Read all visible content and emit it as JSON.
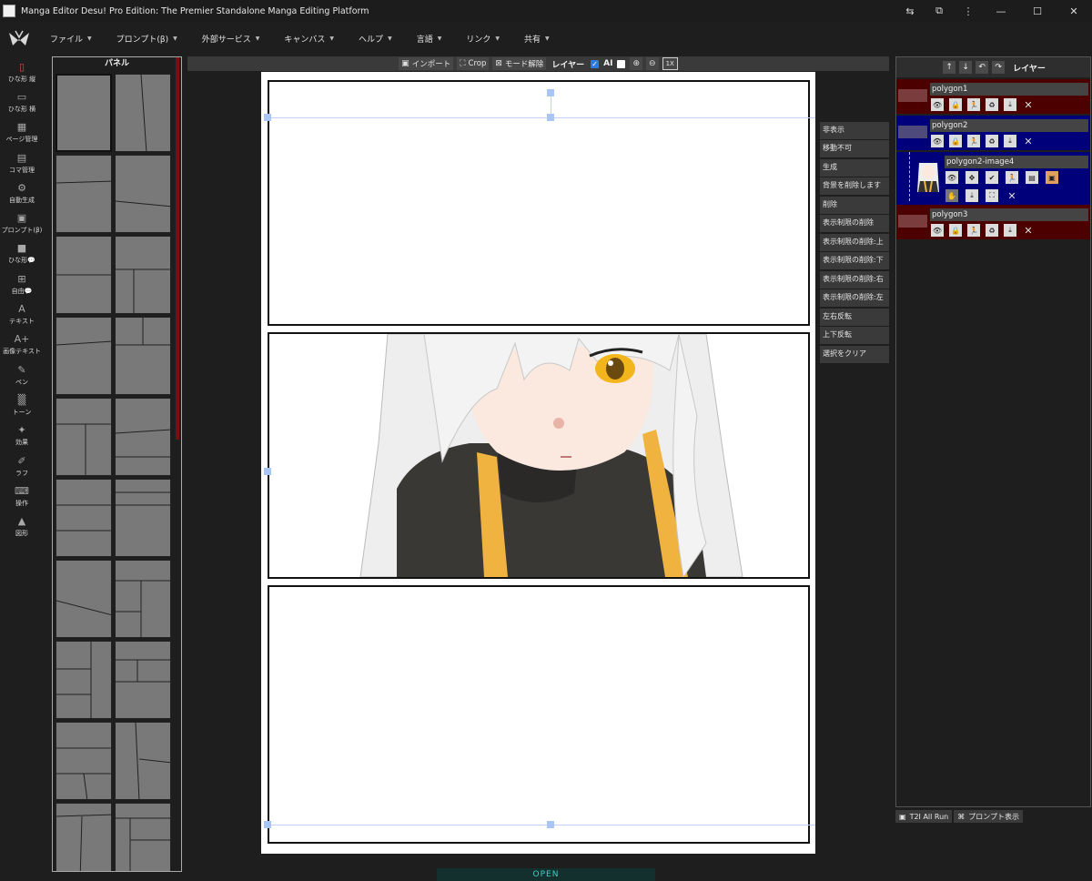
{
  "window": {
    "title": "Manga Editor Desu! Pro Edition: The Premier Standalone Manga Editing Platform"
  },
  "menubar": {
    "items": [
      "ファイル",
      "プロンプト(β)",
      "外部サービス",
      "キャンバス",
      "ヘルプ",
      "言語",
      "リンク",
      "共有"
    ]
  },
  "tools": [
    {
      "label": "ひな形 縦",
      "icon": "portrait-rect-icon"
    },
    {
      "label": "ひな形 横",
      "icon": "landscape-rect-icon"
    },
    {
      "label": "ページ管理",
      "icon": "grid-icon"
    },
    {
      "label": "コマ管理",
      "icon": "panels-icon"
    },
    {
      "label": "自動生成",
      "icon": "robot-icon"
    },
    {
      "label": "プロンプト(β)",
      "icon": "clipboard-icon"
    },
    {
      "label": "ひな形💬",
      "icon": "speech-bubble-icon"
    },
    {
      "label": "自由💬",
      "icon": "bubble-plus-icon"
    },
    {
      "label": "テキスト",
      "icon": "text-icon"
    },
    {
      "label": "画像テキスト",
      "icon": "image-text-icon"
    },
    {
      "label": "ペン",
      "icon": "pen-icon"
    },
    {
      "label": "トーン",
      "icon": "tone-icon"
    },
    {
      "label": "効果",
      "icon": "effect-icon"
    },
    {
      "label": "ラフ",
      "icon": "rough-icon"
    },
    {
      "label": "操作",
      "icon": "gamepad-icon"
    },
    {
      "label": "図形",
      "icon": "shapes-icon"
    }
  ],
  "panel_list": {
    "title": "パネル"
  },
  "canvas_toolbar": {
    "import_label": "インポート",
    "crop_label": "Crop",
    "mode_release_label": "モード解除",
    "layer_label": "レイヤー",
    "ai_label": "AI",
    "ai_checked": true,
    "second_checked": false,
    "zoom_in_icon": "zoom-in-icon",
    "zoom_out_icon": "zoom-out-icon",
    "reset_label": "1X"
  },
  "context_menu": {
    "items": [
      "非表示",
      "移動不可",
      "生成",
      "背景を削除します",
      "削除",
      "表示制限の削除",
      "表示制限の削除:上",
      "表示制限の削除:下",
      "表示制限の削除:右",
      "表示制限の削除:左",
      "左右反転",
      "上下反転",
      "選択をクリア"
    ]
  },
  "layers": {
    "title": "レイヤー",
    "items": [
      {
        "name": "polygon1",
        "swatch": "#7a3c3c",
        "bg": "#4d0000"
      },
      {
        "name": "polygon2",
        "swatch": "#4e4a7c",
        "bg": "#00007a"
      },
      {
        "name": "polygon2-image4",
        "bg": "#00007a"
      },
      {
        "name": "polygon3",
        "swatch": "#7a3c3c",
        "bg": "#4d0000"
      }
    ]
  },
  "bottom": {
    "t2i_label": "T2I All Run",
    "prompt_label": "プロンプト表示",
    "status": "OPEN"
  },
  "colors": {
    "accent_red": "#e04848",
    "layer_red": "#4d0000",
    "layer_blue": "#00007a",
    "selection_blue": "#a9c5f4",
    "open_text": "#3fd0c4"
  }
}
